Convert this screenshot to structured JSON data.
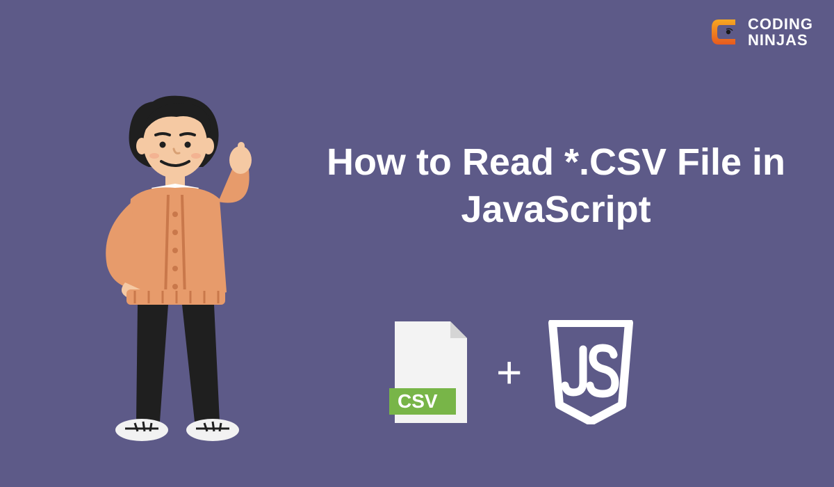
{
  "logo": {
    "line1": "CODING",
    "line2": "NINJAS"
  },
  "title": "How to Read *.CSV File in JavaScript",
  "csv_label": "CSV",
  "js_label": "JS",
  "plus": "+"
}
